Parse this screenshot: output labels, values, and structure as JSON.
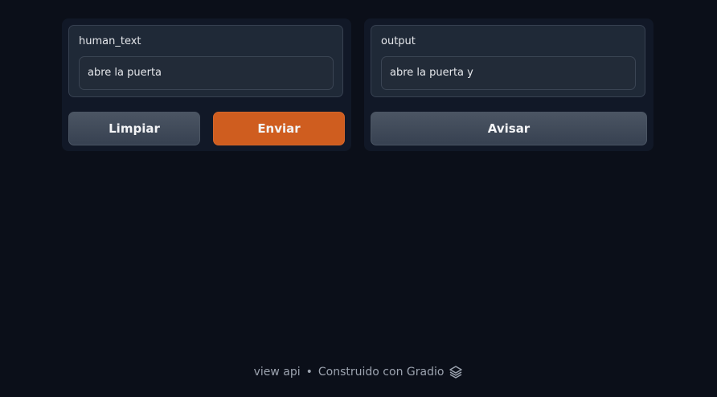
{
  "input_panel": {
    "label": "human_text",
    "value": "abre la puerta",
    "clear_button": "Limpiar",
    "submit_button": "Enviar"
  },
  "output_panel": {
    "label": "output",
    "value": "abre la puerta y",
    "flag_button": "Avisar"
  },
  "footer": {
    "api_link": "view api",
    "separator": "•",
    "built_with": "Construido con Gradio",
    "logo_icon": "gradio-logo-icon"
  },
  "colors": {
    "background": "#0b0f19",
    "panel": "#111827",
    "block": "#1f2937",
    "primary_button": "#cf5d1f",
    "secondary_button": "#4b5563"
  }
}
